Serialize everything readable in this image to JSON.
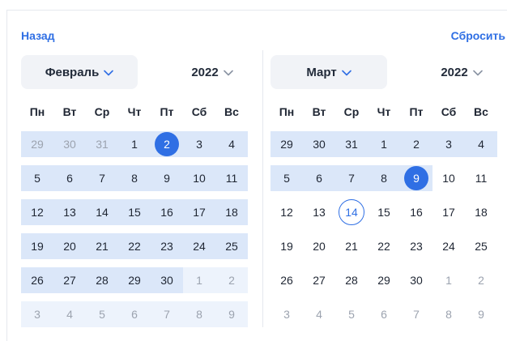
{
  "header": {
    "back_label": "Назад",
    "reset_label": "Сбросить"
  },
  "colors": {
    "accent": "#2f6fe4",
    "range": "#dbe7f9",
    "range_light": "#edf3fc"
  },
  "weekdays": [
    "Пн",
    "Вт",
    "Ср",
    "Чт",
    "Пт",
    "Сб",
    "Вс"
  ],
  "left": {
    "month": "Февраль",
    "year": "2022",
    "weeks": [
      [
        "29",
        "30",
        "31",
        "1",
        "2",
        "3",
        "4"
      ],
      [
        "5",
        "6",
        "7",
        "8",
        "9",
        "10",
        "11"
      ],
      [
        "12",
        "13",
        "14",
        "15",
        "16",
        "17",
        "18"
      ],
      [
        "19",
        "20",
        "21",
        "22",
        "23",
        "24",
        "25"
      ],
      [
        "26",
        "27",
        "28",
        "29",
        "30",
        "1",
        "2"
      ],
      [
        "3",
        "4",
        "5",
        "6",
        "7",
        "8",
        "9"
      ]
    ]
  },
  "right": {
    "month": "Март",
    "year": "2022",
    "weeks": [
      [
        "29",
        "30",
        "31",
        "1",
        "2",
        "3",
        "4"
      ],
      [
        "5",
        "6",
        "7",
        "8",
        "9",
        "10",
        "11"
      ],
      [
        "12",
        "13",
        "14",
        "15",
        "16",
        "17",
        "18"
      ],
      [
        "19",
        "20",
        "21",
        "22",
        "23",
        "24",
        "25"
      ],
      [
        "26",
        "27",
        "28",
        "29",
        "30",
        "1",
        "2"
      ],
      [
        "3",
        "4",
        "5",
        "6",
        "7",
        "8",
        "9"
      ]
    ]
  },
  "selection": {
    "start": "2 Февраль 2022",
    "end": "9 Март 2022",
    "today": "14 Март 2022"
  }
}
